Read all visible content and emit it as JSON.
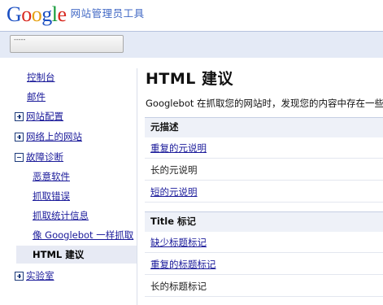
{
  "header": {
    "logo": [
      "G",
      "o",
      "o",
      "g",
      "l",
      "e"
    ],
    "product": "网站管理员工具"
  },
  "topbar": {
    "site_selector": "-----"
  },
  "sidebar": {
    "dashboard": "控制台",
    "messages": "邮件",
    "site_config": "网站配置",
    "your_site_on_web": "网络上的网站",
    "diagnostics": "故障诊断",
    "diagnostics_items": [
      "恶意软件",
      "抓取错误",
      "抓取统计信息",
      "像 Googlebot 一样抓取"
    ],
    "active_item": "HTML 建议",
    "labs": "实验室"
  },
  "main": {
    "title": "HTML 建议",
    "intro": "Googlebot 在抓取您的网站时，发现您的内容中存在一些问",
    "sections": [
      {
        "heading": "元描述",
        "rows": [
          {
            "label": "重复的元说明",
            "link": true
          },
          {
            "label": "长的元说明",
            "link": false
          },
          {
            "label": "短的元说明",
            "link": true
          }
        ]
      },
      {
        "heading": "Title 标记",
        "rows": [
          {
            "label": "缺少标题标记",
            "link": true
          },
          {
            "label": "重复的标题标记",
            "link": true
          },
          {
            "label": "长的标题标记",
            "link": false
          }
        ]
      }
    ]
  }
}
